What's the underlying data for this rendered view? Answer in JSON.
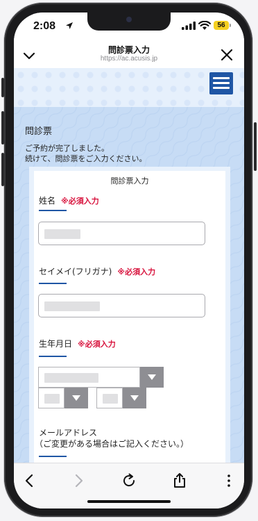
{
  "status_bar": {
    "time": "2:08",
    "battery": "56",
    "icons": [
      "location-arrow-icon",
      "signal-bars-icon",
      "wifi-icon",
      "battery-icon"
    ]
  },
  "browser": {
    "title": "問診票入力",
    "url": "https://ac.acusis.jp",
    "left_icon": "chevron-down-icon",
    "right_icon": "close-icon"
  },
  "site_header": {
    "menu_icon": "hamburger-menu-icon",
    "accent": "#1f56a5"
  },
  "page": {
    "section_title": "問診票",
    "intro_line1": "ご予約が完了しました。",
    "intro_line2": "続けて、問診票をご入力ください。",
    "form_title": "問診票入力"
  },
  "form": {
    "required_mark": "※必須入力",
    "required_color": "#d8133d",
    "name_label": "姓名",
    "kana_label": "セイメイ(フリガナ)",
    "birth_label": "生年月日",
    "email_label_line1": "メールアドレス",
    "email_label_line2": "（ご変更がある場合はご記入ください。）"
  },
  "toolbar": {
    "icons": [
      "back-icon",
      "forward-icon",
      "reload-icon",
      "share-icon",
      "more-icon"
    ]
  }
}
